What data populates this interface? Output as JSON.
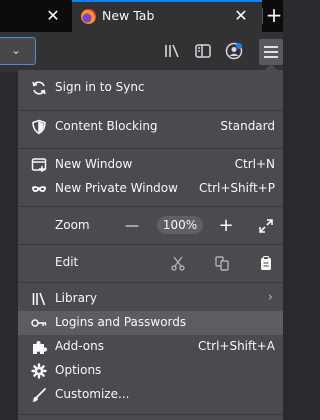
{
  "tabs": {
    "active_title": "New Tab",
    "close_glyph": "✕",
    "new_tab_glyph": "+"
  },
  "toolbar": {
    "icons": [
      "library-icon",
      "sidebar-icon",
      "account-icon",
      "hamburger-menu-icon"
    ]
  },
  "menu": {
    "sync_label": "Sign in to Sync",
    "content_blocking_label": "Content Blocking",
    "content_blocking_value": "Standard",
    "new_window_label": "New Window",
    "new_window_shortcut": "Ctrl+N",
    "private_window_label": "New Private Window",
    "private_window_shortcut": "Ctrl+Shift+P",
    "zoom_label": "Zoom",
    "zoom_out_glyph": "—",
    "zoom_value": "100%",
    "zoom_in_glyph": "+",
    "edit_label": "Edit",
    "library_label": "Library",
    "logins_label": "Logins and Passwords",
    "addons_label": "Add-ons",
    "addons_shortcut": "Ctrl+Shift+A",
    "options_label": "Options",
    "customize_label": "Customize..."
  },
  "colors": {
    "panel_bg": "#4a4a4f",
    "hover_bg": "#5c5c61",
    "tab_accent": "#0a84ff"
  }
}
